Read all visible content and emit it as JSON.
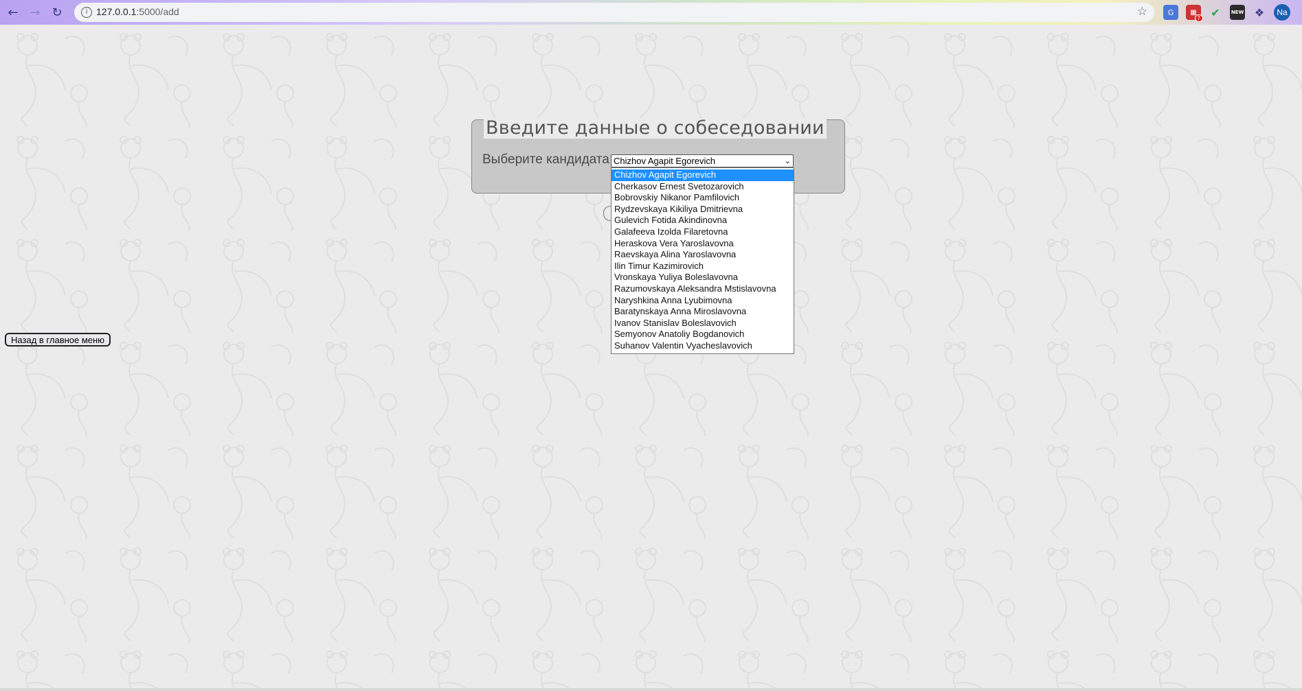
{
  "browser": {
    "url_host": "127.0.0.1",
    "url_path": ":5000/add",
    "avatar_text": "Na",
    "extensions": [
      "translate-icon",
      "tab-extension-icon",
      "shield-icon",
      "news-extension-icon",
      "puzzle-icon"
    ],
    "tab_extension_badge": "?",
    "news_extension_text": "NEW"
  },
  "form": {
    "legend": "Введите данные о собеседовании",
    "candidate_label": "Выберите кандидата",
    "selected_candidate": "Chizhov Agapit Egorevich",
    "options": [
      "Chizhov Agapit Egorevich",
      "Cherkasov Ernest Svetozarovich",
      "Bobrovskiy Nikanor Pamfilovich",
      "Rydzevskaya Kikiliya Dmitrievna",
      "Gulevich Fotida Akindinovna",
      "Galafeeva Izolda Filaretovna",
      "Heraskova Vera Yaroslavovna",
      "Raevskaya Alina Yaroslavovna",
      "Ilin Timur Kazimirovich",
      "Vronskaya Yuliya Boleslavovna",
      "Razumovskaya Aleksandra Mstislavovna",
      "Naryshkina Anna Lyubimovna",
      "Baratynskaya Anna Miroslavovna",
      "Ivanov Stanislav Boleslavovich",
      "Semyonov Anatoliy Bogdanovich",
      "Suhanov Valentin Vyacheslavovich"
    ]
  },
  "back_button_label": "Назад в главное меню",
  "colors": {
    "page_background": "#ebebeb",
    "form_background": "#c8c8c8",
    "selected_option": "#1e90ff"
  }
}
